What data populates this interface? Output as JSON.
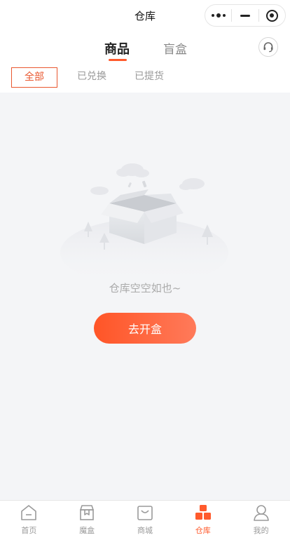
{
  "window": {
    "title": "仓库"
  },
  "tabs": {
    "goods": "商品",
    "blind_box": "盲盒",
    "active": "商品"
  },
  "filters": {
    "all": "全部",
    "exchanged": "已兑换",
    "delivered": "已提货",
    "active": "全部"
  },
  "empty_state": {
    "message": "仓库空空如也~",
    "button_label": "去开盒"
  },
  "bottom_nav": {
    "items": [
      {
        "label": "首页",
        "icon": "home-icon"
      },
      {
        "label": "魔盒",
        "icon": "magic-box-icon"
      },
      {
        "label": "商城",
        "icon": "mall-icon"
      },
      {
        "label": "仓库",
        "icon": "warehouse-icon"
      },
      {
        "label": "我的",
        "icon": "profile-icon"
      }
    ],
    "active": "仓库"
  },
  "colors": {
    "accent": "#ff5a2c",
    "filter_active": "#e9572f",
    "inactive_text": "#999999",
    "background": "#f4f5f7"
  }
}
